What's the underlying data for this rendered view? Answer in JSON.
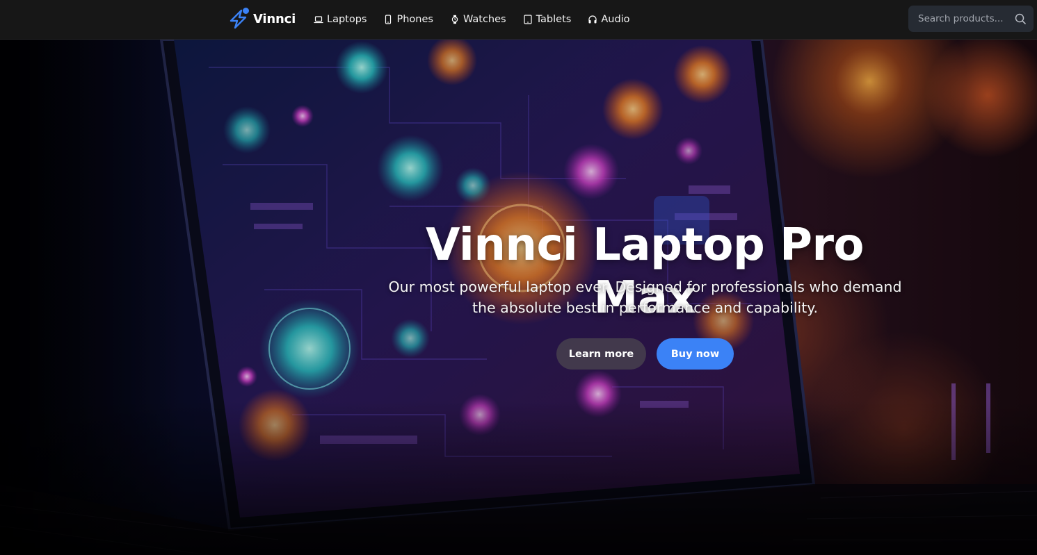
{
  "brand": {
    "name": "Vinnci",
    "icon": "lightning-bolt-icon",
    "accent": "#3b82f6"
  },
  "nav": {
    "items": [
      {
        "label": "Laptops",
        "icon": "laptop-icon"
      },
      {
        "label": "Phones",
        "icon": "phone-icon"
      },
      {
        "label": "Watches",
        "icon": "watch-icon"
      },
      {
        "label": "Tablets",
        "icon": "tablet-icon"
      },
      {
        "label": "Audio",
        "icon": "headphones-icon"
      }
    ]
  },
  "search": {
    "placeholder": "Search products...",
    "value": "",
    "icon": "search-icon"
  },
  "hero": {
    "title": "Vinnci Laptop Pro Max",
    "subtitle": "Our most powerful laptop ever. Designed for professionals who demand the absolute best in performance and capability.",
    "secondary_cta": "Learn more",
    "primary_cta": "Buy now"
  },
  "colors": {
    "nav_bg": "#171717",
    "search_bg": "#262b33",
    "primary_button": "#3b82f6",
    "secondary_button": "#48424e"
  }
}
